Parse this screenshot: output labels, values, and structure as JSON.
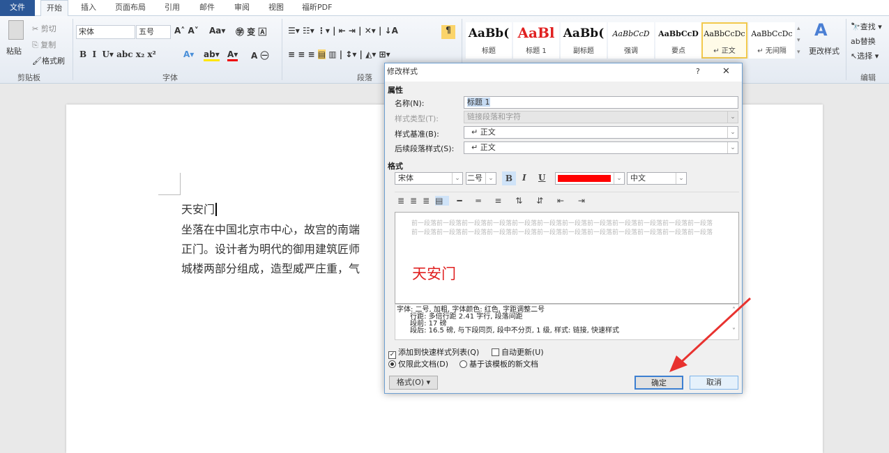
{
  "tabs": [
    "文件",
    "开始",
    "插入",
    "页面布局",
    "引用",
    "邮件",
    "审阅",
    "视图",
    "福昕PDF"
  ],
  "ribbon": {
    "clipboard": {
      "paste": "粘贴",
      "cut": "剪切",
      "copy": "复制",
      "format_painter": "格式刷",
      "label": "剪贴板"
    },
    "font": {
      "font_name": "宋体",
      "font_size": "五号",
      "label": "字体"
    },
    "paragraph": {
      "label": "段落"
    },
    "styles": [
      {
        "preview": "AaBb(",
        "name": "标题"
      },
      {
        "preview": "AaBl",
        "name": "标题 1"
      },
      {
        "preview": "AaBb(",
        "name": "副标题"
      },
      {
        "preview": "AaBbCcD",
        "name": "强调"
      },
      {
        "preview": "AaBbCcD",
        "name": "要点"
      },
      {
        "preview": "AaBbCcDc",
        "name": "↵ 正文"
      },
      {
        "preview": "AaBbCcDc",
        "name": "↵ 无间隔"
      }
    ],
    "change_styles": "更改样式",
    "editing": {
      "find": "查找",
      "replace": "替换",
      "select": "选择",
      "label": "编辑"
    }
  },
  "document": {
    "lines": [
      "天安门",
      "坐落在中国北京市中心，故宫的南端",
      "正门。设计者为明代的御用建筑匠师",
      "城楼两部分组成，造型威严庄重，气"
    ]
  },
  "dialog": {
    "title": "修改样式",
    "help": "?",
    "close": "✕",
    "section_properties": "属性",
    "name_label": "名称(N):",
    "name_value": "标题 1",
    "type_label": "样式类型(T):",
    "type_value": "链接段落和字符",
    "based_label": "样式基准(B):",
    "based_value": "↵ 正文",
    "next_label": "后续段落样式(S):",
    "next_value": "↵ 正文",
    "section_format": "格式",
    "font": "宋体",
    "size": "二号",
    "bold": "B",
    "italic": "I",
    "underline": "U",
    "color": "#ff0000",
    "lang": "中文",
    "preview_prev": "前一段落前一段落前一段落前一段落前一段落前一段落前一段落前一段落前一段落前一段落前一段落前一段落前一段落前一段落前一段落前一段落前一段落前一段落前一段落前一段落前一段落前一段落前一段落前一段落",
    "preview_text": "天安门",
    "description": "字体: 二号, 加粗, 字体颜色: 红色, 字距调整二号\n      行距: 多倍行距 2.41 字行, 段落间距\n      段前: 17 磅\n      段后: 16.5 磅, 与下段同页, 段中不分页, 1 级, 样式: 链接, 快速样式",
    "add_quick": "添加到快速样式列表(Q)",
    "auto_update": "自动更新(U)",
    "only_doc": "仅限此文档(D)",
    "new_docs": "基于该模板的新文档",
    "format_btn": "格式(O) ▾",
    "ok": "确定",
    "cancel": "取消"
  }
}
